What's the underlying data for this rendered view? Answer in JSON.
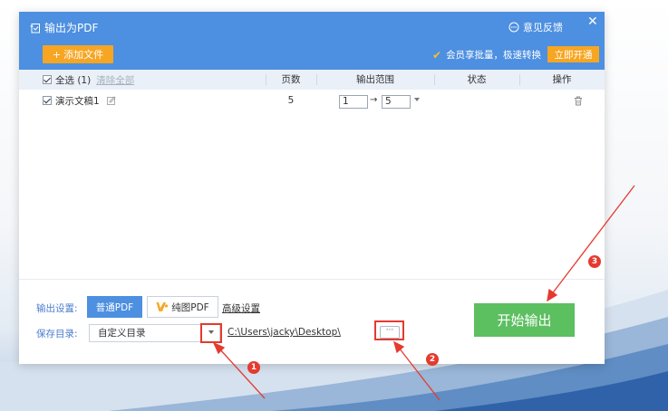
{
  "window": {
    "title": "输出为PDF",
    "feedback_label": "意见反馈",
    "close_glyph": "✕"
  },
  "toolbar": {
    "add_file_label": "添加文件",
    "add_glyph": "+",
    "vip_check_glyph": "✔",
    "vip_text": "会员享批量，极速转换",
    "open_vip_label": "立即开通"
  },
  "table": {
    "select_all_label": "全选 (1)",
    "clear_all_label": "清除全部",
    "columns": {
      "pages": "页数",
      "range": "输出范围",
      "status": "状态",
      "actions": "操作"
    },
    "rows": [
      {
        "name": "演示文稿1",
        "pages": "5",
        "range_from": "1",
        "range_to": "5",
        "arrow": "→",
        "status": ""
      }
    ]
  },
  "settings": {
    "output_label": "输出设置:",
    "normal_pdf_label": "普通PDF",
    "image_pdf_label": "纯图PDF",
    "advanced_label": "高级设置",
    "save_dir_label": "保存目录:",
    "dir_option": "自定义目录",
    "path": "C:\\Users\\jacky\\Desktop\\",
    "browse_label": "···",
    "start_label": "开始输出"
  },
  "annotations": {
    "badge_1": "1",
    "badge_2": "2",
    "badge_3": "3"
  },
  "colors": {
    "titlebar": "#4d8fe0",
    "accent_orange": "#f6a623",
    "start_green": "#5cbf60",
    "annotation_red": "#e53a2f"
  }
}
